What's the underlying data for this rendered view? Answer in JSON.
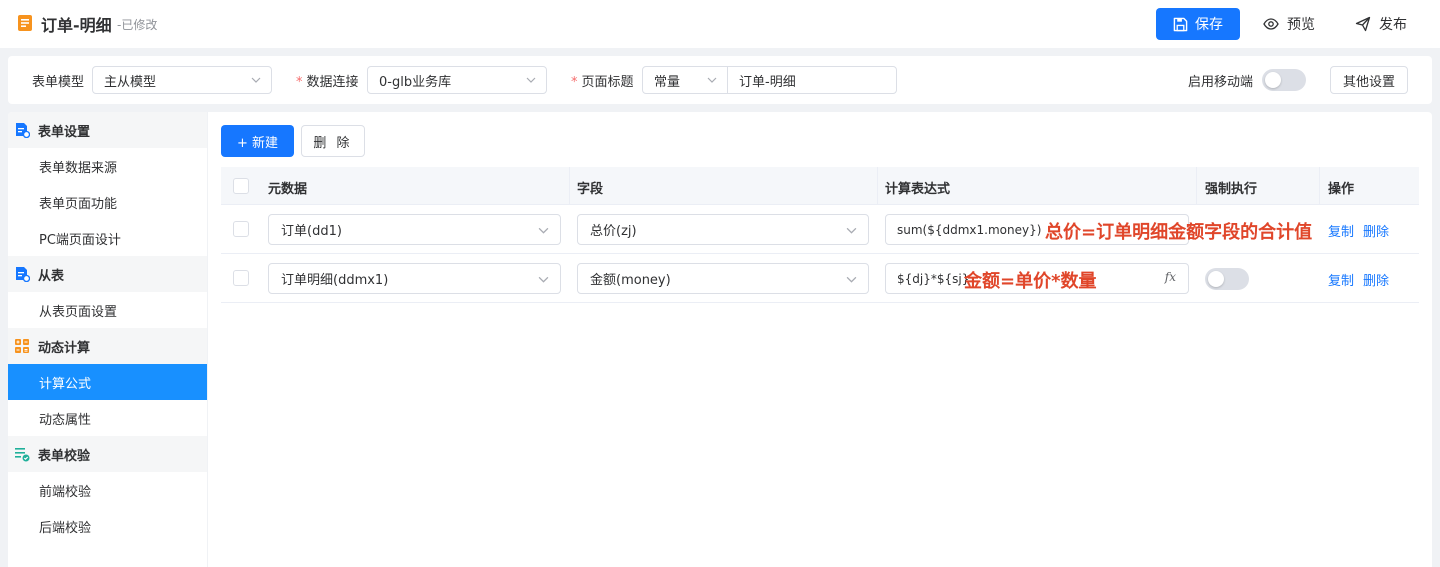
{
  "header": {
    "title": "订单-明细",
    "status": "-已修改",
    "save_label": "保存",
    "preview_label": "预览",
    "publish_label": "发布",
    "accent_color": "#1677ff"
  },
  "config": {
    "form_model_label": "表单模型",
    "form_model_value": "主从模型",
    "data_conn_label": "数据连接",
    "data_conn_value": "0-glb业务库",
    "page_title_label": "页面标题",
    "page_title_type": "常量",
    "page_title_value": "订单-明细",
    "mobile_label": "启用移动端",
    "mobile_enabled": false,
    "other_settings_label": "其他设置",
    "required_mark": "*"
  },
  "sidebar": {
    "groups": [
      {
        "label": "表单设置",
        "icon": "form-settings-icon",
        "items": [
          "表单数据来源",
          "表单页面功能",
          "PC端页面设计"
        ]
      },
      {
        "label": "从表",
        "icon": "sub-table-icon",
        "items": [
          "从表页面设置"
        ]
      },
      {
        "label": "动态计算",
        "icon": "calculator-icon",
        "items": [
          "计算公式",
          "动态属性"
        ]
      },
      {
        "label": "表单校验",
        "icon": "validation-icon",
        "items": [
          "前端校验",
          "后端校验"
        ]
      }
    ],
    "active_item": "计算公式"
  },
  "toolbar": {
    "new_label": "+ 新建",
    "delete_label": "删 除"
  },
  "table": {
    "columns": [
      "元数据",
      "字段",
      "计算表达式",
      "强制执行",
      "操作"
    ],
    "rows": [
      {
        "metadata": "订单(dd1)",
        "field": "总价(zj)",
        "expression": "sum(${ddmx1.money})",
        "annotation": "总价=订单明细金额字段的合计值",
        "force": false,
        "copy_label": "复制",
        "delete_label": "删除"
      },
      {
        "metadata": "订单明细(ddmx1)",
        "field": "金额(money)",
        "expression": "${dj}*${sj}",
        "annotation": "金额=单价*数量",
        "force": false,
        "copy_label": "复制",
        "delete_label": "删除"
      }
    ]
  }
}
